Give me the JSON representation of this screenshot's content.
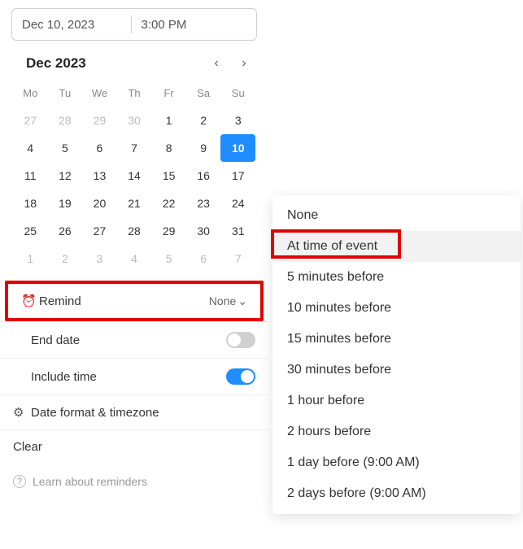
{
  "date_bar": {
    "date": "Dec 10, 2023",
    "time": "3:00 PM"
  },
  "calendar": {
    "title": "Dec 2023",
    "dow": [
      "Mo",
      "Tu",
      "We",
      "Th",
      "Fr",
      "Sa",
      "Su"
    ],
    "weeks": [
      [
        {
          "d": "27",
          "o": true
        },
        {
          "d": "28",
          "o": true
        },
        {
          "d": "29",
          "o": true
        },
        {
          "d": "30",
          "o": true
        },
        {
          "d": "1"
        },
        {
          "d": "2"
        },
        {
          "d": "3"
        }
      ],
      [
        {
          "d": "4"
        },
        {
          "d": "5"
        },
        {
          "d": "6"
        },
        {
          "d": "7"
        },
        {
          "d": "8"
        },
        {
          "d": "9"
        },
        {
          "d": "10",
          "sel": true
        }
      ],
      [
        {
          "d": "11"
        },
        {
          "d": "12"
        },
        {
          "d": "13"
        },
        {
          "d": "14"
        },
        {
          "d": "15"
        },
        {
          "d": "16"
        },
        {
          "d": "17"
        }
      ],
      [
        {
          "d": "18"
        },
        {
          "d": "19"
        },
        {
          "d": "20"
        },
        {
          "d": "21"
        },
        {
          "d": "22"
        },
        {
          "d": "23"
        },
        {
          "d": "24"
        }
      ],
      [
        {
          "d": "25"
        },
        {
          "d": "26"
        },
        {
          "d": "27"
        },
        {
          "d": "28"
        },
        {
          "d": "29"
        },
        {
          "d": "30"
        },
        {
          "d": "31"
        }
      ],
      [
        {
          "d": "1",
          "o": true
        },
        {
          "d": "2",
          "o": true
        },
        {
          "d": "3",
          "o": true
        },
        {
          "d": "4",
          "o": true
        },
        {
          "d": "5",
          "o": true
        },
        {
          "d": "6",
          "o": true
        },
        {
          "d": "7",
          "o": true
        }
      ]
    ]
  },
  "rows": {
    "remind_label": "Remind",
    "remind_value": "None",
    "end_date_label": "End date",
    "include_time_label": "Include time",
    "date_fmt_label": "Date format & timezone",
    "clear_label": "Clear",
    "learn_label": "Learn about reminders"
  },
  "toggles": {
    "end_date": false,
    "include_time": true
  },
  "icons": {
    "alarm": "⏰",
    "gear": "⚙",
    "help": "?",
    "chev_down": "⌄",
    "chev_left": "‹",
    "chev_right": "›"
  },
  "menu": {
    "items": [
      "None",
      "At time of event",
      "5 minutes before",
      "10 minutes before",
      "15 minutes before",
      "30 minutes before",
      "1 hour before",
      "2 hours before",
      "1 day before (9:00 AM)",
      "2 days before (9:00 AM)"
    ],
    "hover_index": 1
  }
}
